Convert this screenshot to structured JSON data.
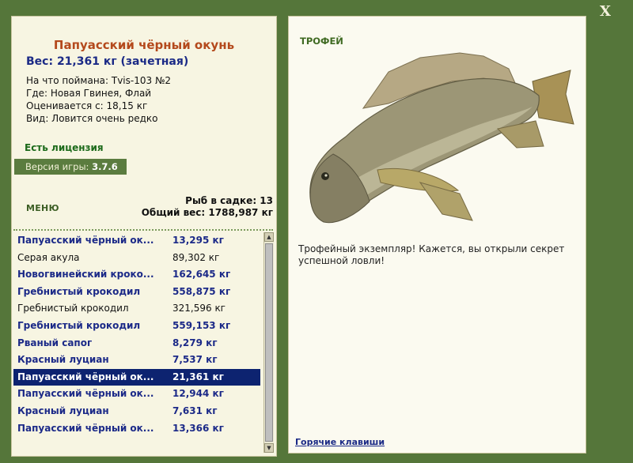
{
  "window": {
    "close_label": "X"
  },
  "fish": {
    "title": "Папуасский чёрный окунь",
    "weight_line": "Вес: 21,361 кг (зачетная)",
    "info": [
      "На что поймана: Tvis-103 №2",
      "Где: Новая Гвинея, Флай",
      "Оценивается с: 18,15 кг",
      "Вид: Ловится очень редко"
    ]
  },
  "license": "Есть лицензия",
  "version": {
    "label": "Версия игры:",
    "value": "3.7.6"
  },
  "menu_label": "МЕНЮ",
  "stats": {
    "fish_count": "Рыб в садке: 13",
    "total_weight": "Общий вес: 1788,987 кг"
  },
  "catch_list": [
    {
      "name": "Папуасский чёрный ок...",
      "weight": "13,295 кг",
      "trophy": true,
      "selected": false
    },
    {
      "name": "Серая акула",
      "weight": "89,302 кг",
      "trophy": false,
      "selected": false
    },
    {
      "name": "Новогвинейский кроко...",
      "weight": "162,645 кг",
      "trophy": true,
      "selected": false
    },
    {
      "name": "Гребнистый крокодил",
      "weight": "558,875 кг",
      "trophy": true,
      "selected": false
    },
    {
      "name": "Гребнистый крокодил",
      "weight": "321,596 кг",
      "trophy": false,
      "selected": false
    },
    {
      "name": "Гребнистый крокодил",
      "weight": "559,153 кг",
      "trophy": true,
      "selected": false
    },
    {
      "name": "Рваный сапог",
      "weight": "8,279 кг",
      "trophy": true,
      "selected": false
    },
    {
      "name": "Красный луциан",
      "weight": "7,537 кг",
      "trophy": true,
      "selected": false
    },
    {
      "name": "Папуасский чёрный ок...",
      "weight": "21,361 кг",
      "trophy": true,
      "selected": true
    },
    {
      "name": "Папуасский чёрный ок...",
      "weight": "12,944 кг",
      "trophy": true,
      "selected": false
    },
    {
      "name": "Красный луциан",
      "weight": "7,631 кг",
      "trophy": true,
      "selected": false
    },
    {
      "name": "Папуасский чёрный ок...",
      "weight": "13,366 кг",
      "trophy": true,
      "selected": false
    }
  ],
  "trophy_panel": {
    "label": "ТРОФЕЙ",
    "description": "Трофейный экземпляр! Кажется, вы открыли секрет успешной ловли!",
    "hotkeys_link": "Горячие клавиши"
  },
  "colors": {
    "background": "#55763a",
    "title": "#b4491c",
    "trophy_text": "#1c2a88",
    "selection": "#0d2370",
    "license": "#1c6a1a"
  }
}
